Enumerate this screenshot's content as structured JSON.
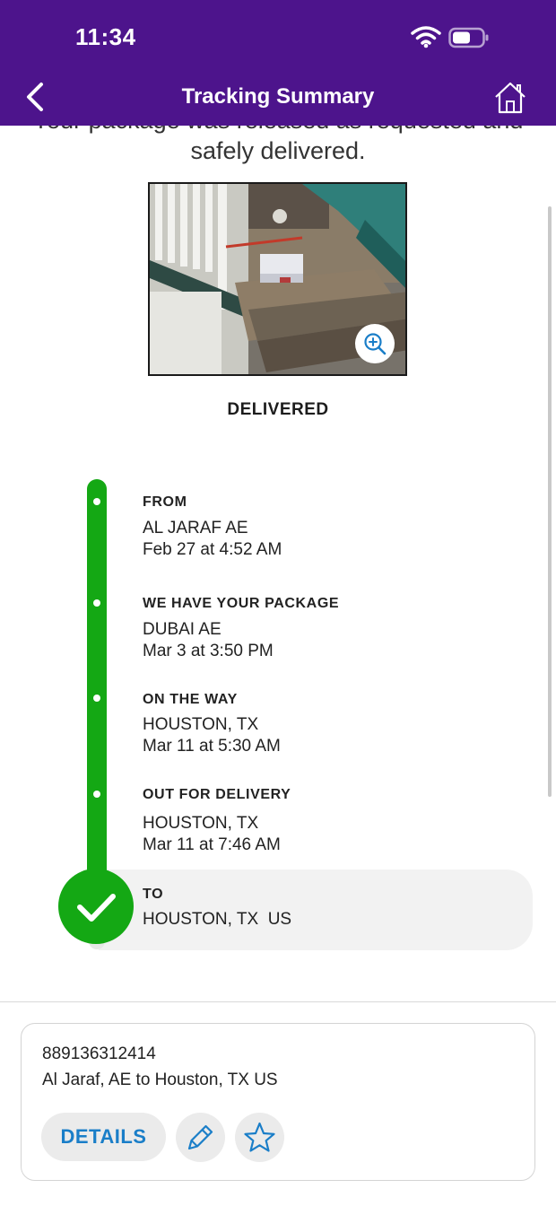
{
  "status_bar": {
    "time": "11:34"
  },
  "nav": {
    "title": "Tracking Summary"
  },
  "summary": {
    "cut_text": "Your package was released as requested and",
    "delivered_text": "safely delivered."
  },
  "status": "DELIVERED",
  "timeline": [
    {
      "title": "FROM",
      "location": "AL JARAF AE",
      "time": "Feb 27 at 4:52 AM"
    },
    {
      "title": "WE HAVE YOUR PACKAGE",
      "location": "DUBAI AE",
      "time": "Mar 3 at 3:50 PM"
    },
    {
      "title": "ON THE WAY",
      "location": "HOUSTON, TX",
      "time": "Mar 11 at 5:30 AM"
    },
    {
      "title": "OUT FOR DELIVERY",
      "location": "HOUSTON, TX",
      "time": "Mar 11 at 7:46 AM"
    },
    {
      "title": "TO",
      "location": "HOUSTON, TX  US"
    }
  ],
  "package_card": {
    "tracking_number": "889136312414",
    "route": "Al Jaraf, AE to Houston, TX US",
    "details_label": "DETAILS"
  },
  "colors": {
    "header": "#4d148c",
    "progress": "#14a814",
    "accent": "#1a7ec8"
  }
}
